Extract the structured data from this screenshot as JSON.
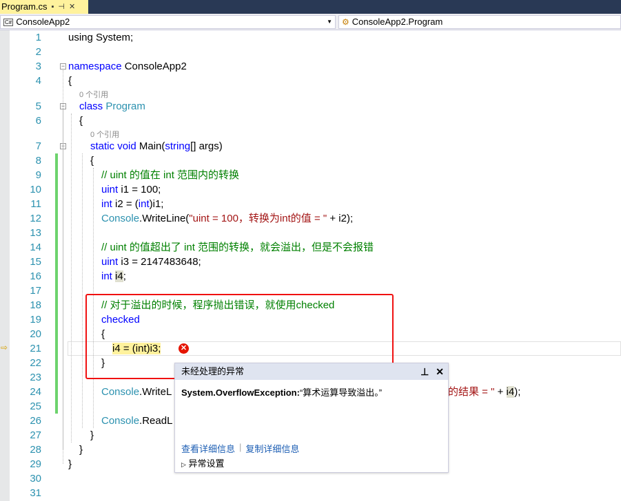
{
  "tab": {
    "title": "Program.cs",
    "lock_icon": "🔒",
    "pin_icon": "⊣",
    "close_icon": "✕"
  },
  "nav": {
    "project": "ConsoleApp2",
    "cs_badge": "C#",
    "class": "ConsoleApp2.Program"
  },
  "codelens": "0 个引用",
  "lines": [
    {
      "n": "1",
      "indent": 0,
      "t": [
        [
          "using System;",
          ""
        ]
      ]
    },
    {
      "n": "2",
      "indent": 0,
      "t": []
    },
    {
      "n": "3",
      "indent": 0,
      "t": [
        [
          "namespace ",
          "kw"
        ],
        [
          "ConsoleApp2",
          ""
        ]
      ]
    },
    {
      "n": "4",
      "indent": 0,
      "t": [
        [
          "{",
          ""
        ]
      ]
    },
    {
      "n": "5",
      "indent": 1,
      "lens": true,
      "t": [
        [
          "class ",
          "kw"
        ],
        [
          "Program",
          "ty"
        ]
      ]
    },
    {
      "n": "6",
      "indent": 1,
      "t": [
        [
          "{",
          ""
        ]
      ]
    },
    {
      "n": "7",
      "indent": 2,
      "lens": true,
      "t": [
        [
          "static ",
          "kw"
        ],
        [
          "void ",
          "kw"
        ],
        [
          "Main(",
          ""
        ],
        [
          "string",
          "kw"
        ],
        [
          "[] args)",
          ""
        ]
      ]
    },
    {
      "n": "8",
      "indent": 2,
      "t": [
        [
          "{",
          ""
        ]
      ]
    },
    {
      "n": "9",
      "indent": 3,
      "t": [
        [
          "// uint 的值在 int 范围内的转换",
          "cm"
        ]
      ]
    },
    {
      "n": "10",
      "indent": 3,
      "t": [
        [
          "uint ",
          "kw"
        ],
        [
          "i1 = 100;",
          ""
        ]
      ]
    },
    {
      "n": "11",
      "indent": 3,
      "t": [
        [
          "int ",
          "kw"
        ],
        [
          "i2 = (",
          ""
        ],
        [
          "int",
          "kw"
        ],
        [
          ")i1;",
          ""
        ]
      ]
    },
    {
      "n": "12",
      "indent": 3,
      "t": [
        [
          "Console",
          "ty"
        ],
        [
          ".WriteLine(",
          ""
        ],
        [
          "\"uint = 100，转换为int的值 = \"",
          "st"
        ],
        [
          " + i2);",
          ""
        ]
      ]
    },
    {
      "n": "13",
      "indent": 3,
      "t": []
    },
    {
      "n": "14",
      "indent": 3,
      "t": [
        [
          "// uint 的值超出了 int 范围的转换，就会溢出，但是不会报错",
          "cm"
        ]
      ]
    },
    {
      "n": "15",
      "indent": 3,
      "t": [
        [
          "uint ",
          "kw"
        ],
        [
          "i3 = 2147483648;",
          ""
        ]
      ]
    },
    {
      "n": "16",
      "indent": 3,
      "t": [
        [
          "int ",
          "kw"
        ],
        [
          "i4",
          "ref"
        ],
        [
          ";",
          ""
        ]
      ]
    },
    {
      "n": "17",
      "indent": 3,
      "t": []
    },
    {
      "n": "18",
      "indent": 3,
      "t": [
        [
          "// 对于溢出的时候，程序抛出错误，就使用checked",
          "cm"
        ]
      ]
    },
    {
      "n": "19",
      "indent": 3,
      "t": [
        [
          "checked",
          "kw"
        ]
      ]
    },
    {
      "n": "20",
      "indent": 3,
      "t": [
        [
          "{",
          ""
        ]
      ]
    },
    {
      "n": "21",
      "indent": 4,
      "t": [
        [
          "i4 = (int)i3;",
          "hl"
        ]
      ]
    },
    {
      "n": "22",
      "indent": 3,
      "t": [
        [
          "}",
          ""
        ]
      ]
    },
    {
      "n": "23",
      "indent": 3,
      "t": []
    },
    {
      "n": "24",
      "indent": 3,
      "t": [
        [
          "Console",
          "ty"
        ],
        [
          ".WriteL",
          ""
        ]
      ]
    },
    {
      "n": "25",
      "indent": 3,
      "t": []
    },
    {
      "n": "26",
      "indent": 3,
      "t": [
        [
          "Console",
          "ty"
        ],
        [
          ".ReadL",
          ""
        ]
      ]
    },
    {
      "n": "27",
      "indent": 2,
      "t": [
        [
          "}",
          ""
        ]
      ]
    },
    {
      "n": "28",
      "indent": 1,
      "t": [
        [
          "}",
          ""
        ]
      ]
    },
    {
      "n": "29",
      "indent": 0,
      "t": [
        [
          "}",
          ""
        ]
      ]
    },
    {
      "n": "30",
      "indent": 0,
      "t": []
    },
    {
      "n": "31",
      "indent": 0,
      "t": []
    }
  ],
  "line24_tail": [
    [
      "的结果 = \"",
      "st"
    ],
    [
      " + ",
      ""
    ],
    [
      "i4",
      "ref"
    ],
    [
      ");",
      ""
    ]
  ],
  "exception": {
    "title": "未经处理的异常",
    "pin_icon": "pin",
    "close_icon": "✕",
    "type": "System.OverflowException:",
    "message": "“算术运算导致溢出。”",
    "link_details": "查看详细信息",
    "link_copy": "复制详细信息",
    "settings": "异常设置",
    "error_icon": "✕"
  },
  "colors": {
    "keyword": "#0000ff",
    "type": "#2b91af",
    "comment": "#008000",
    "string": "#a31515",
    "highlight": "#fff29d",
    "error": "#e51400"
  }
}
